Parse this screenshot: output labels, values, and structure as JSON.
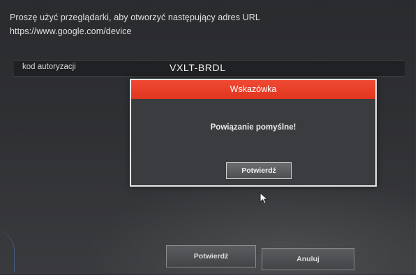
{
  "screen": {
    "instruction_line1": "Proszę użyć przeglądarki, aby otworzyć następujący adres URL",
    "instruction_line2": "https://www.google.com/device"
  },
  "auth_table": {
    "label": "kod autoryzacji",
    "value": "VXLT-BRDL"
  },
  "dialog": {
    "title": "Wskazówka",
    "message": "Powiązanie pomyślne!",
    "confirm_label": "Potwierdź"
  },
  "footer": {
    "confirm_label": "Potwierdź",
    "cancel_label": "Anuluj"
  },
  "colors": {
    "dialog_header": "#e0351f",
    "screen_background": "#2f3033",
    "dialog_border": "#e6e6e6"
  },
  "icons": {
    "cursor": "mouse-pointer-icon"
  }
}
